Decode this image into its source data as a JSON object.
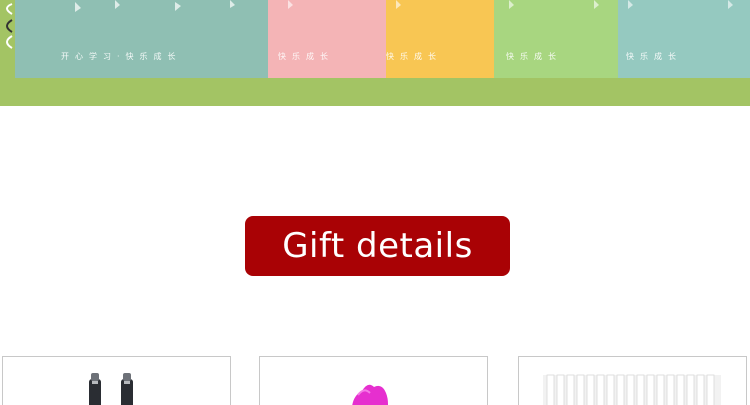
{
  "banner": {
    "books": [
      {
        "text": "开心学习·快乐成长",
        "color": "#8fbfb3"
      },
      {
        "text": "快乐成长",
        "color": "#f4b4b6"
      },
      {
        "text": "快乐成长",
        "color": "#f8c653"
      },
      {
        "text": "快乐成长",
        "color": "#a8d680"
      },
      {
        "text": "快乐成长",
        "color": "#95c9c0"
      }
    ],
    "background_color": "#a3c464"
  },
  "section": {
    "title": "Gift details",
    "title_color": "#a90205"
  },
  "gifts": [
    {
      "item": "pen-pair"
    },
    {
      "item": "pink-pen-grip"
    },
    {
      "item": "pencil-lead-refills"
    }
  ]
}
